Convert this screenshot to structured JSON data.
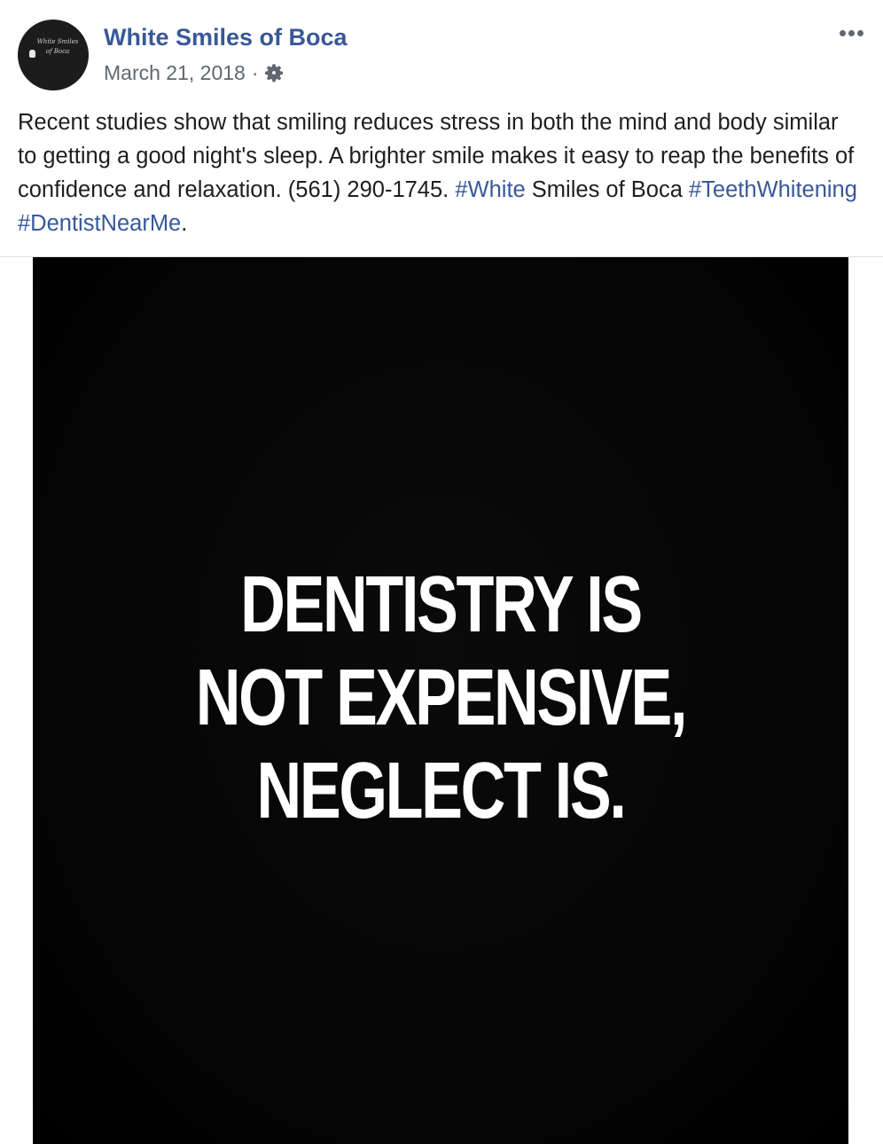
{
  "post": {
    "page_name": "White Smiles of Boca",
    "date": "March 21, 2018",
    "meta_separator": "·",
    "privacy_icon": "gear-icon",
    "more_icon": "more-options-icon",
    "avatar": {
      "logo_line1": "White Smiles",
      "logo_line2": "of Boca"
    },
    "text": {
      "main": "Recent studies show that smiling reduces stress in both the mind and body similar to getting a good night's sleep. A brighter smile makes it easy to reap the benefits of confidence and relaxation. (561) 290-1745. ",
      "hashtag_white": "#White",
      "middle": " Smiles of Boca ",
      "hashtag_teeth": "#TeethWhitening",
      "space": " ",
      "hashtag_dentist": "#DentistNearMe",
      "end": "."
    },
    "image": {
      "line1": "DENTISTRY IS",
      "line2": "NOT EXPENSIVE,",
      "line3": "NEGLECT IS."
    }
  },
  "colors": {
    "link": "#385898",
    "text": "#1c1e21",
    "meta": "#606770",
    "image_background": "#000000"
  }
}
